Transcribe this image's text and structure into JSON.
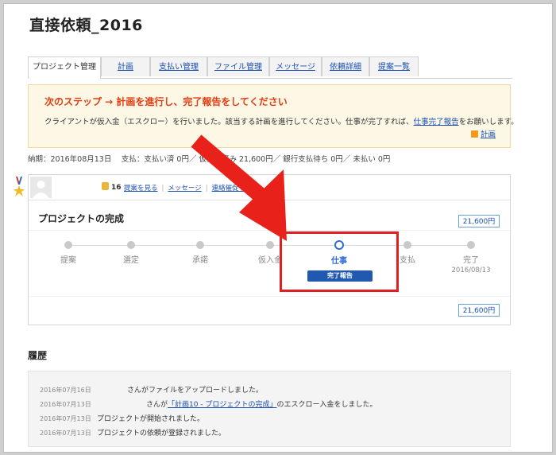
{
  "page": {
    "title": "直接依頼_2016"
  },
  "tabs": [
    {
      "label": "プロジェクト管理",
      "active": true
    },
    {
      "label": "計画"
    },
    {
      "label": "支払い管理"
    },
    {
      "label": "ファイル管理"
    },
    {
      "label": "メッセージ"
    },
    {
      "label": "依頼詳細"
    },
    {
      "label": "提案一覧"
    }
  ],
  "notice": {
    "title": "次のステップ → 計画を進行し、完了報告をしてください",
    "body_pre": "クライアントが仮入金（エスクロー）を行いました。該当する計画を進行してください。仕事が完了すれば、",
    "body_link": "仕事完了報告",
    "body_post": "をお願いします。",
    "rss_label": "計画"
  },
  "summary": {
    "text": "納期：2016年08月13日　 支払：支払い済 0円／ 仮払い済み 21,600円／ 銀行支払待ち 0円／ 未払い 0円"
  },
  "card": {
    "rank": "16",
    "links": [
      "提案を見る",
      "メッセージ",
      "連絡催促する"
    ],
    "project_title": "プロジェクトの完成",
    "amount_top": "21,600円",
    "amount_bottom": "21,600円",
    "steps": [
      {
        "label": "提案"
      },
      {
        "label": "選定"
      },
      {
        "label": "承諾"
      },
      {
        "label": "仮入金"
      },
      {
        "label": "仕事",
        "current": true,
        "button": "完了報告"
      },
      {
        "label": "支払"
      },
      {
        "label": "完了",
        "date": "2016/08/13"
      }
    ]
  },
  "history": {
    "title": "履歴",
    "rows": [
      {
        "date": "2016年07月16日",
        "text": "さんがファイルをアップロードしました。"
      },
      {
        "date": "2016年07月13日",
        "pre": "さんが",
        "link": "「計画10 - プロジェクトの完成」",
        "post": "のエスクロー入金をしました。"
      },
      {
        "date": "2016年07月13日",
        "text": "プロジェクトが開始されました。"
      },
      {
        "date": "2016年07月13日",
        "text": "プロジェクトの依頼が登録されました。"
      }
    ]
  },
  "colors": {
    "accent": "#2158b0",
    "highlight": "#e02020",
    "notice_title": "#e53b10"
  }
}
